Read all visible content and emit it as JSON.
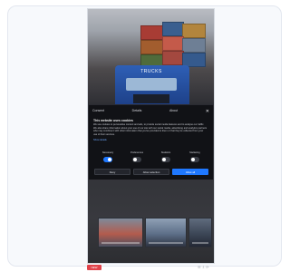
{
  "dialog": {
    "tabs": [
      "Consent",
      "Details",
      "About"
    ],
    "close_icon": "close-icon",
    "title": "This website uses cookies",
    "body": "We use cookies to personalise content and ads, to provide social media features and to analyse our traffic. We also share information about your use of our site with our social media, advertising and analytics partners who may combine it with other information that you've provided to them or that they've collected from your use of their services.",
    "link": "Show details"
  },
  "toggles": [
    {
      "label": "Necessary",
      "on": true
    },
    {
      "label": "Preferences",
      "on": false
    },
    {
      "label": "Statistics",
      "on": false
    },
    {
      "label": "Marketing",
      "on": false
    }
  ],
  "buttons": {
    "deny": "Deny",
    "allow_selection": "Allow selection",
    "allow_all": "Allow all"
  },
  "truck": {
    "brand": "TRUCKS"
  },
  "bottom": {
    "badge": "NEW",
    "icons": "☰ ⇩ ⟳"
  },
  "colors": {
    "accent": "#1f78ff",
    "badge": "#e1434b"
  }
}
